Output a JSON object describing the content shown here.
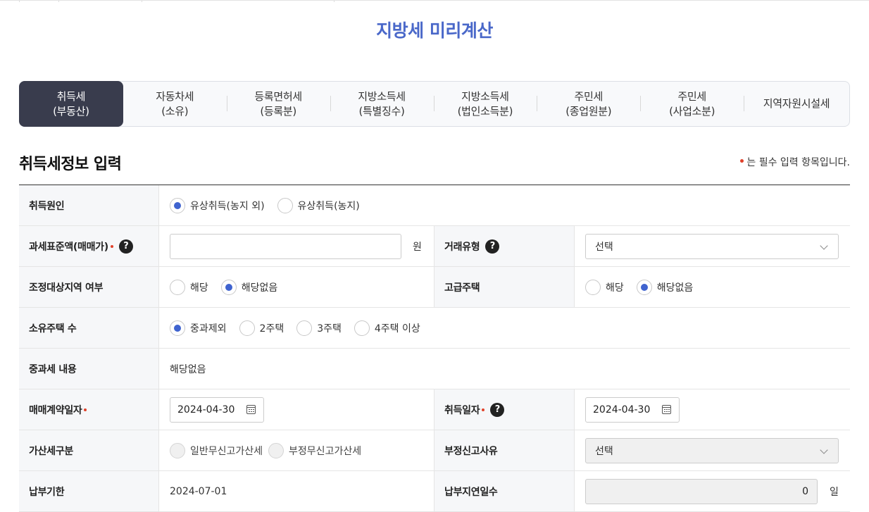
{
  "page_title": "지방세 미리계산",
  "tabs": [
    {
      "line1": "취득세",
      "line2": "(부동산)"
    },
    {
      "line1": "자동차세",
      "line2": "(소유)"
    },
    {
      "line1": "등록면허세",
      "line2": "(등록분)"
    },
    {
      "line1": "지방소득세",
      "line2": "(특별징수)"
    },
    {
      "line1": "지방소득세",
      "line2": "(법인소득분)"
    },
    {
      "line1": "주민세",
      "line2": "(종업원분)"
    },
    {
      "line1": "주민세",
      "line2": "(사업소분)"
    },
    {
      "line1": "지역자원시설세",
      "line2": ""
    }
  ],
  "section_title": "취득세정보 입력",
  "required_note": "는 필수 입력 항목입니다.",
  "help_glyph": "?",
  "form": {
    "acquisition_cause": {
      "label": "취득원인",
      "options": [
        "유상취득(농지 외)",
        "유상취득(농지)"
      ],
      "selected": "유상취득(농지 외)"
    },
    "tax_base": {
      "label": "과세표준액(매매가)",
      "value": "",
      "unit": "원"
    },
    "trade_type": {
      "label": "거래유형",
      "value": "선택"
    },
    "adjusted_area": {
      "label": "조정대상지역 여부",
      "options": [
        "해당",
        "해당없음"
      ],
      "selected": "해당없음"
    },
    "luxury_house": {
      "label": "고급주택",
      "options": [
        "해당",
        "해당없음"
      ],
      "selected": "해당없음"
    },
    "house_count": {
      "label": "소유주택 수",
      "options": [
        "중과제외",
        "2주택",
        "3주택",
        "4주택 이상"
      ],
      "selected": "중과제외"
    },
    "heavy_tax": {
      "label": "중과세 내용",
      "value": "해당없음"
    },
    "contract_date": {
      "label": "매매계약일자",
      "value": "2024-04-30"
    },
    "acquisition_date": {
      "label": "취득일자",
      "value": "2024-04-30"
    },
    "penalty_type": {
      "label": "가산세구분",
      "options": [
        "일반무신고가산세",
        "부정무신고가산세"
      ]
    },
    "fraud_reason": {
      "label": "부정신고사유",
      "value": "선택"
    },
    "due_date": {
      "label": "납부기한",
      "value": "2024-07-01"
    },
    "late_days": {
      "label": "납부지연일수",
      "value": "0",
      "unit": "일"
    }
  },
  "colors": {
    "accent": "#4a68c9",
    "active_tab": "#393c4d",
    "radio_on": "#3f63cf",
    "required": "#e0412a"
  },
  "icons": {
    "help": "question-circle-icon",
    "calendar": "calendar-icon",
    "select": "chevron-down-icon"
  }
}
